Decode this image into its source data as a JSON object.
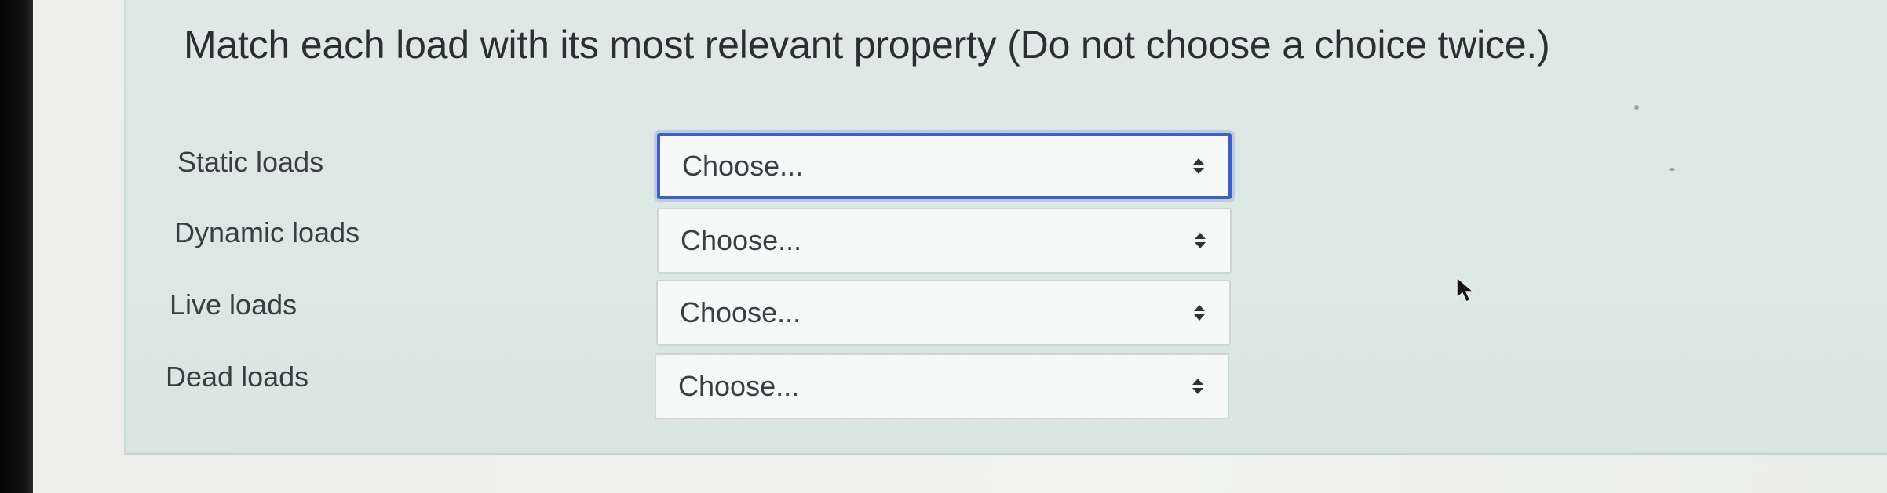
{
  "question": {
    "prompt": "Match each load with its most relevant property (Do not choose a choice twice.)"
  },
  "rows": [
    {
      "label": "Static loads",
      "select_value": "Choose..."
    },
    {
      "label": "Dynamic loads",
      "select_value": "Choose..."
    },
    {
      "label": "Live loads",
      "select_value": "Choose..."
    },
    {
      "label": "Dead loads",
      "select_value": "Choose..."
    }
  ],
  "icons": {
    "select_indicator": "sort-icon",
    "pointer": "mouse-cursor-icon"
  },
  "colors": {
    "focus_border": "#3f5fc4",
    "panel_background": "#dee9e6",
    "text": "#3a3e43"
  }
}
